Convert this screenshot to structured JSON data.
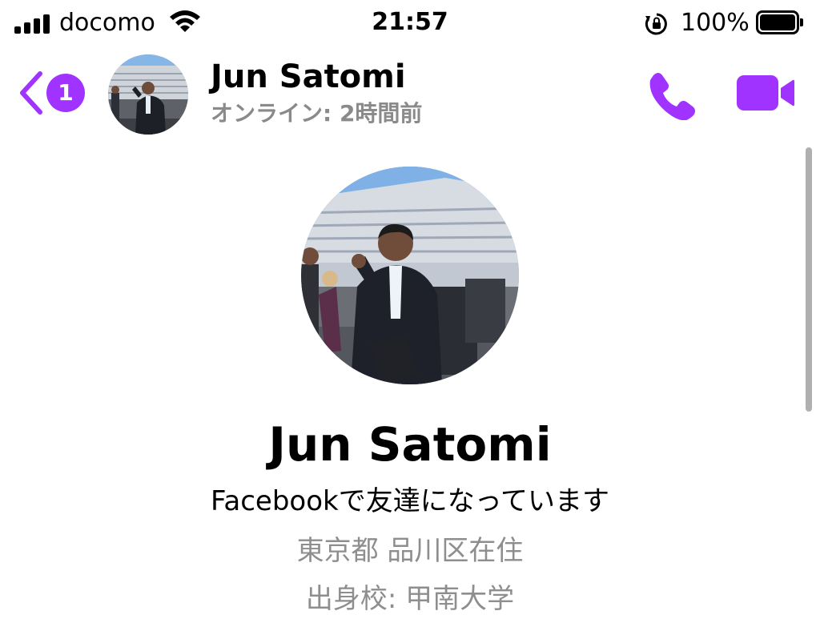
{
  "status_bar": {
    "carrier": "docomo",
    "time": "21:57",
    "battery_percent": "100%"
  },
  "header": {
    "unread_count": "1",
    "name": "Jun Satomi",
    "status": "オンライン: 2時間前"
  },
  "profile": {
    "name": "Jun Satomi",
    "friend_status": "Facebookで友達になっています",
    "location": "東京都 品川区在住",
    "school": "出身校: 甲南大学"
  },
  "colors": {
    "accent": "#a033ff",
    "secondary_text": "#8e8e8e"
  },
  "icons": [
    "signal-icon",
    "wifi-icon",
    "rotation-lock-icon",
    "battery-icon",
    "back-chevron-icon",
    "phone-icon",
    "video-camera-icon"
  ]
}
